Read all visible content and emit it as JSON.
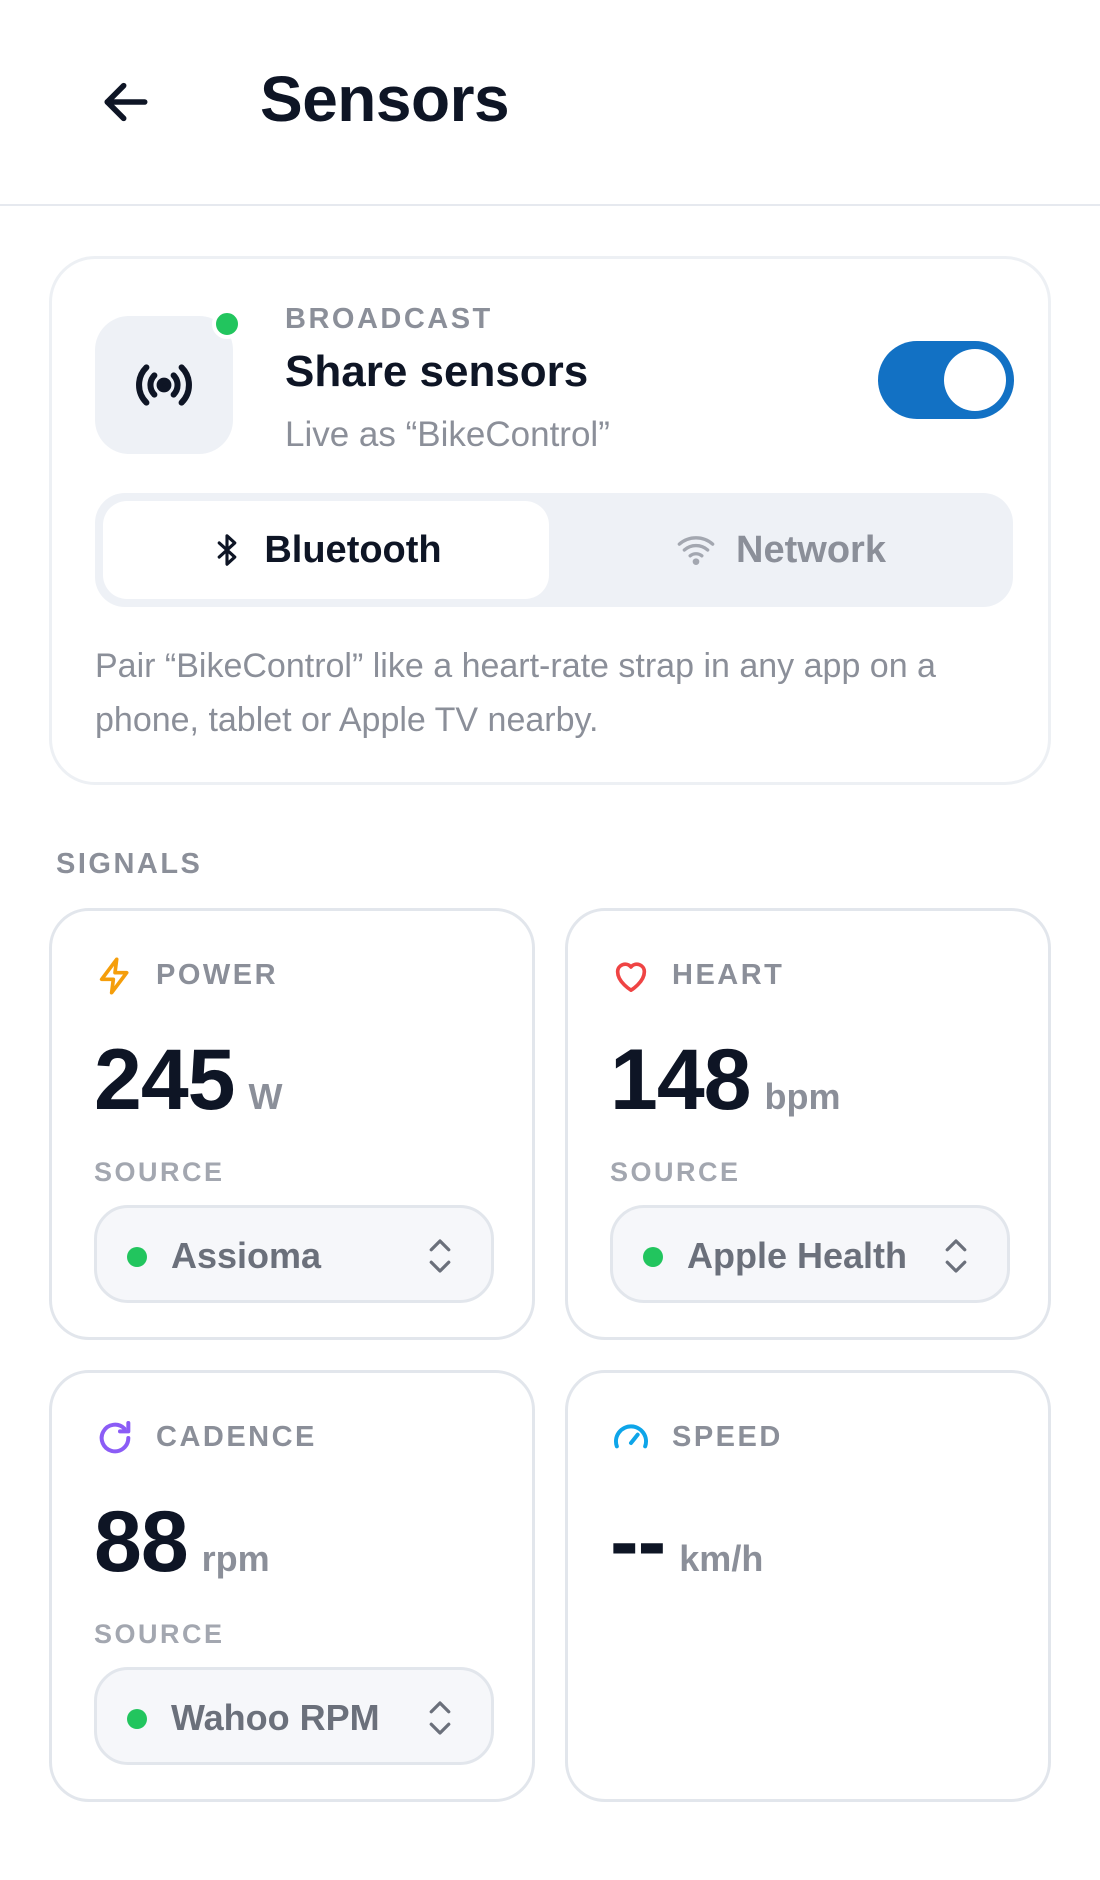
{
  "header": {
    "title": "Sensors",
    "back_icon": "arrow-left-icon"
  },
  "broadcast": {
    "eyebrow": "BROADCAST",
    "title": "Share sensors",
    "subtitle": "Live as “BikeControl”",
    "enabled": true,
    "icon": "broadcast-icon",
    "status_color": "#22c55e",
    "toggle_color": "#1271c4",
    "modes": [
      {
        "label": "Bluetooth",
        "icon": "bluetooth-icon",
        "selected": true
      },
      {
        "label": "Network",
        "icon": "wifi-icon",
        "selected": false
      }
    ],
    "help": "Pair “BikeControl” like a heart-rate strap in any app on a phone, tablet or Apple TV nearby."
  },
  "signals": {
    "title": "SIGNALS",
    "source_label": "SOURCE",
    "items": [
      {
        "label": "POWER",
        "value": "245",
        "unit": "W",
        "icon": "bolt-icon",
        "icon_color": "#f59e0b",
        "source": "Assioma"
      },
      {
        "label": "HEART",
        "value": "148",
        "unit": "bpm",
        "icon": "heart-icon",
        "icon_color": "#ef4444",
        "source": "Apple Health"
      },
      {
        "label": "CADENCE",
        "value": "88",
        "unit": "rpm",
        "icon": "refresh-icon",
        "icon_color": "#8b5cf6",
        "source": "Wahoo RPM"
      },
      {
        "label": "SPEED",
        "value": "--",
        "unit": "km/h",
        "icon": "gauge-icon",
        "icon_color": "#0ea5e9"
      }
    ]
  }
}
